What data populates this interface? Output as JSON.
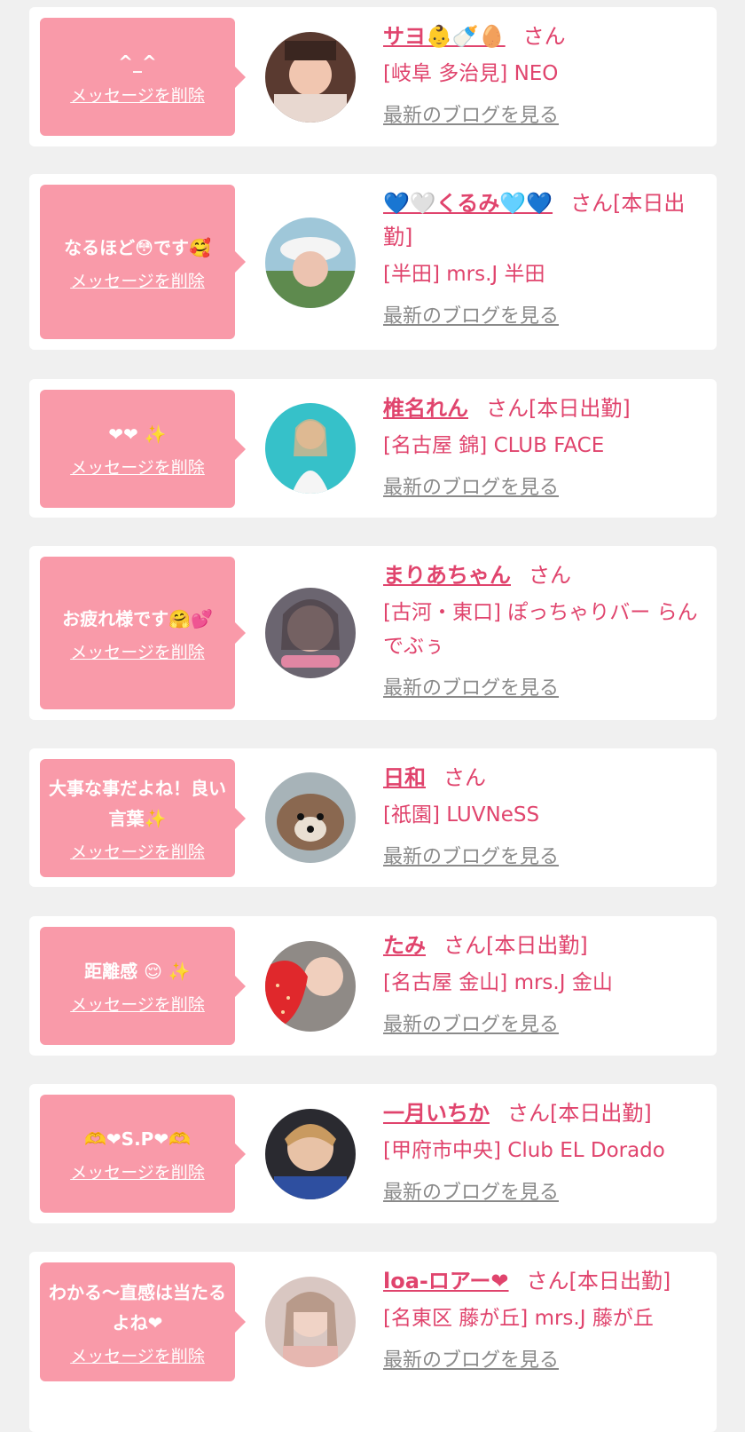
{
  "delete_label": "メッセージを削除",
  "san_label": "さん",
  "blog_label": "最新のブログを見る",
  "cards": [
    {
      "message": "^_^",
      "name": "サヨ👶🍼🥚",
      "suffix": "さん",
      "shop": "[岐阜 多治見] NEO"
    },
    {
      "message": "なるほど😳です🥰",
      "name": "💙🤍くるみ🩵💙",
      "suffix": "さん[本日出勤]",
      "shop": "[半田] mrs.J 半田"
    },
    {
      "message": "❤❤ ✨",
      "name": "椎名れん",
      "suffix": "さん[本日出勤]",
      "shop": "[名古屋 錦] CLUB FACE"
    },
    {
      "message": "お疲れ様です🤗💕",
      "name": "まりあちゃん",
      "suffix": "さん",
      "shop": "[古河・東口] ぽっちゃりバー らんでぶぅ"
    },
    {
      "message": "大事な事だよね！良い言葉✨",
      "name": "日和",
      "suffix": "さん",
      "shop": "[祇園] LUVNeSS"
    },
    {
      "message": "距離感 😌 ✨",
      "name": "たみ",
      "suffix": "さん[本日出勤]",
      "shop": "[名古屋 金山] mrs.J 金山"
    },
    {
      "message": "🫶❤S.P❤🫶",
      "name": "一月いちか",
      "suffix": "さん[本日出勤]",
      "shop": "[甲府市中央] Club EL Dorado"
    },
    {
      "message": "わかる〜直感は当たるよね❤",
      "name": "loa-ロアー❤",
      "suffix": "さん[本日出勤]",
      "shop": "[名東区 藤が丘] mrs.J 藤が丘"
    }
  ],
  "colors": {
    "accent": "#e0446d",
    "bubble": "#f99aa9",
    "background": "#f0f0f0",
    "link_gray": "#8a8a8a"
  }
}
